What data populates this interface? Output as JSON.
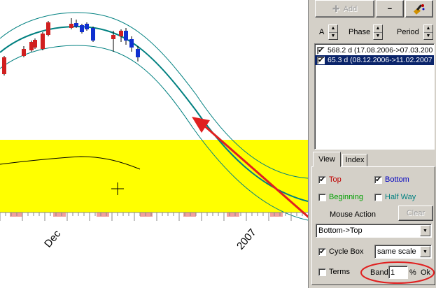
{
  "chart": {
    "x_labels": [
      "Dec",
      "2007"
    ]
  },
  "toolbar": {
    "add_label": "Add",
    "minus_label": "−",
    "add_icon": "plus-icon",
    "paint_icon": "paintbrush-icon"
  },
  "params": {
    "a_label": "A",
    "phase_label": "Phase",
    "period_label": "Period"
  },
  "cycles": [
    {
      "label": "568.2 d (17.08.2006->07.03.200",
      "checked": true,
      "selected": false
    },
    {
      "label": "65.3 d (08.12.2006->11.02.2007",
      "checked": true,
      "selected": true
    }
  ],
  "tabs": [
    {
      "label": "View",
      "active": true
    },
    {
      "label": "Index",
      "active": false
    }
  ],
  "view": {
    "top_label": "Top",
    "bottom_label": "Bottom",
    "beginning_label": "Beginning",
    "halfway_label": "Half Way",
    "mouse_action_label": "Mouse Action",
    "clear_label": "Clear",
    "direction_value": "Bottom->Top",
    "cycle_box_label": "Cycle Box",
    "scale_value": "same scale",
    "terms_label": "Terms",
    "band_label": "Band",
    "band_value": "1",
    "percent_label": "%",
    "ok_label": "Ok"
  },
  "colors": {
    "top": "#c00000",
    "bottom": "#0000c0",
    "beginning": "#00a000",
    "halfway": "#008080",
    "band_fill": "#ffff00",
    "cycle_line": "#008080",
    "annotation": "#e02020"
  }
}
